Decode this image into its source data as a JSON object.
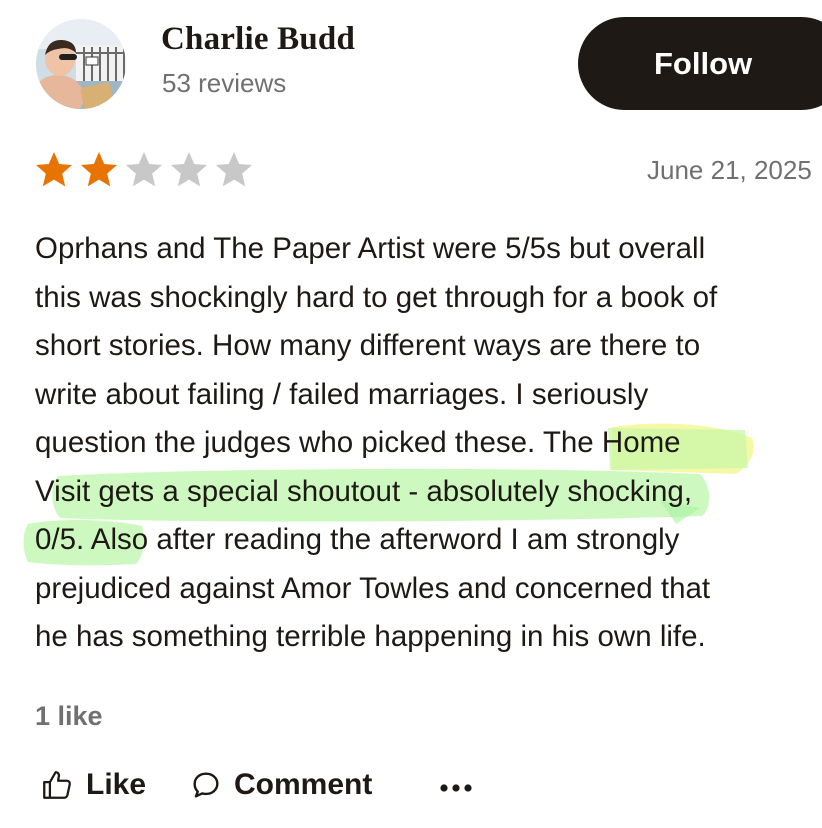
{
  "reviewer": {
    "name": "Charlie Budd",
    "reviews_count": "53 reviews"
  },
  "follow_button": {
    "label": "Follow"
  },
  "rating": {
    "value": 2,
    "max": 5,
    "filled_color": "#e87400",
    "empty_color": "#c8c8c8"
  },
  "review": {
    "date": "June 21, 2025",
    "lines": [
      "Oprhans and The Paper Artist were 5/5s but overall",
      "this was shockingly hard to get through for a book of",
      "short stories. How many different ways are there to",
      "write about failing / failed marriages. I seriously",
      "question the judges who picked these. The Home",
      "Visit gets a special shoutout - absolutely shocking,",
      "0/5. Also after reading the afterword I am strongly",
      "prejudiced against Amor Towles and concerned that",
      "he has something terrible happening in his own life."
    ],
    "highlight_color": "#b6f7a6"
  },
  "likes": {
    "count_label": "1 like"
  },
  "actions": {
    "like_label": "Like",
    "like_icon": "thumbs-up-icon",
    "comment_label": "Comment",
    "comment_icon": "speech-bubble-icon",
    "more_icon": "more-dots-icon"
  }
}
